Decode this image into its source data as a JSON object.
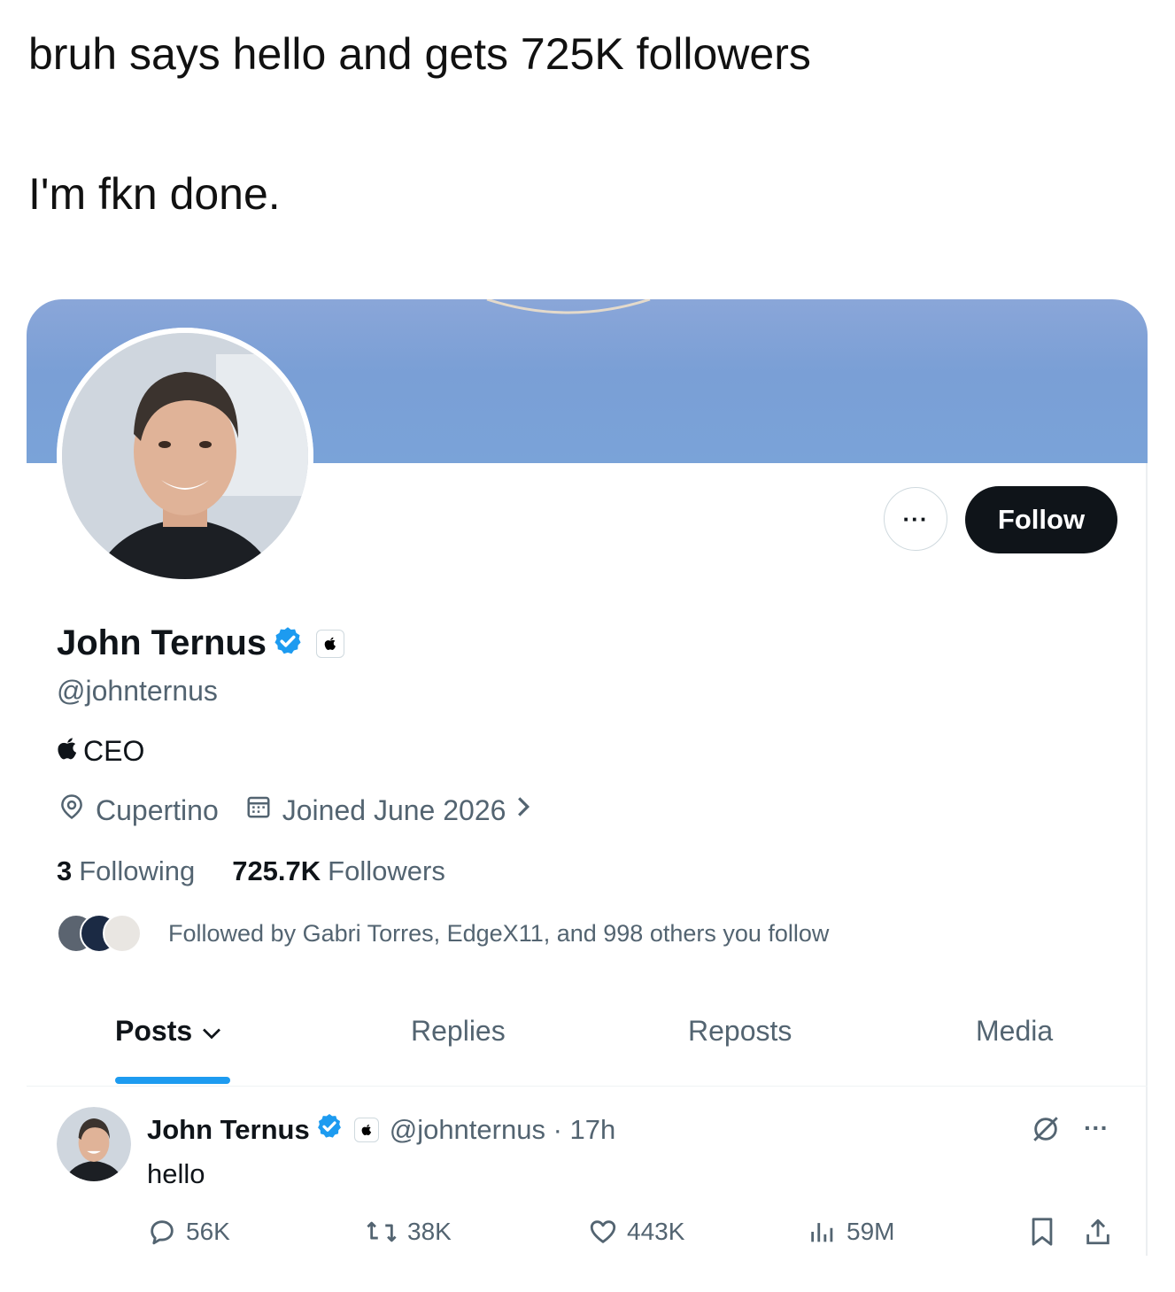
{
  "caption": {
    "line1": "bruh says hello and gets 725K followers",
    "line2": "I'm fkn done."
  },
  "profile": {
    "more_label": "···",
    "follow_label": "Follow",
    "name": "John Ternus",
    "handle": "@johnternus",
    "bio_icon": "apple-logo-icon",
    "bio": "CEO",
    "location": "Cupertino",
    "joined": "Joined June 2026",
    "following_count": "3",
    "following_label": "Following",
    "followers_count": "725.7K",
    "followers_label": "Followers",
    "followed_by": "Followed by Gabri Torres, EdgeX11, and 998 others you follow"
  },
  "tabs": [
    {
      "label": "Posts",
      "active": true
    },
    {
      "label": "Replies"
    },
    {
      "label": "Reposts"
    },
    {
      "label": "Media"
    }
  ],
  "post": {
    "name": "John Ternus",
    "handle_time": "@johnternus · 17h",
    "text": "hello",
    "more_label": "···",
    "replies": "56K",
    "reposts": "38K",
    "likes": "443K",
    "views": "59M"
  },
  "colors": {
    "verified": "#1d9bf0",
    "follow_button": "#0f1419",
    "banner": "#7a9fd6",
    "secondary_text": "#536471"
  }
}
